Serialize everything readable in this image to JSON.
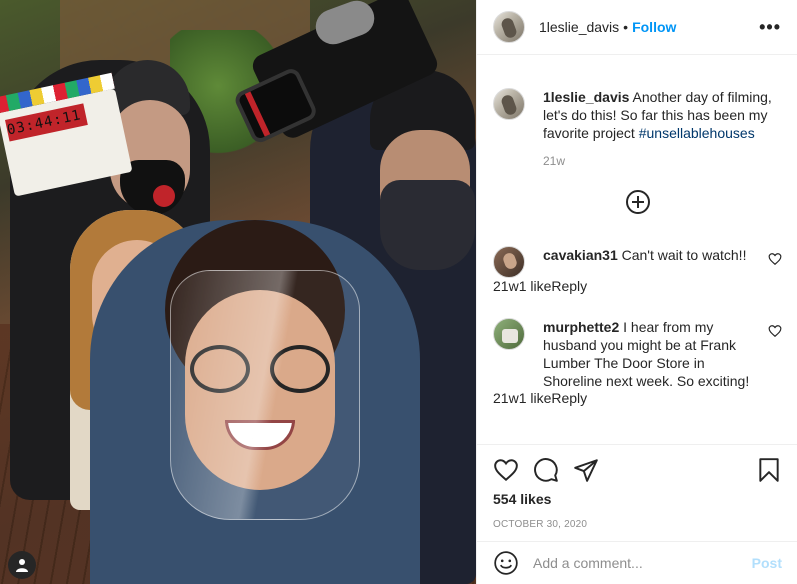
{
  "header": {
    "username": "1leslie_davis",
    "separator": "•",
    "follow_label": "Follow",
    "more_label": "•••"
  },
  "caption": {
    "username": "1leslie_davis",
    "text": " Another day of filming, let's do this! So far this has been my favorite project ",
    "hashtag": "#unsellablehouses",
    "time": "21w"
  },
  "photo": {
    "clapper_digits": "03:44:11"
  },
  "comments": [
    {
      "username": "cavakian31",
      "text": " Can't wait to watch!!",
      "time": "21w",
      "likes": "1 like",
      "reply_label": "Reply"
    },
    {
      "username": "murphette2",
      "text": " I hear from my husband you might be at Frank Lumber The Door Store in Shoreline next week. So exciting!",
      "time": "21w",
      "likes": "1 like",
      "reply_label": "Reply"
    }
  ],
  "actions": {
    "icons": [
      "heart-icon",
      "comment-icon",
      "share-icon",
      "bookmark-icon"
    ],
    "likes": "554 likes",
    "date": "OCTOBER 30, 2020"
  },
  "add_comment": {
    "placeholder": "Add a comment...",
    "post_label": "Post"
  },
  "colors": {
    "accent": "#0095f6",
    "hashtag": "#00376b",
    "muted": "#8e8e8e",
    "post_disabled": "#b2dffc"
  }
}
